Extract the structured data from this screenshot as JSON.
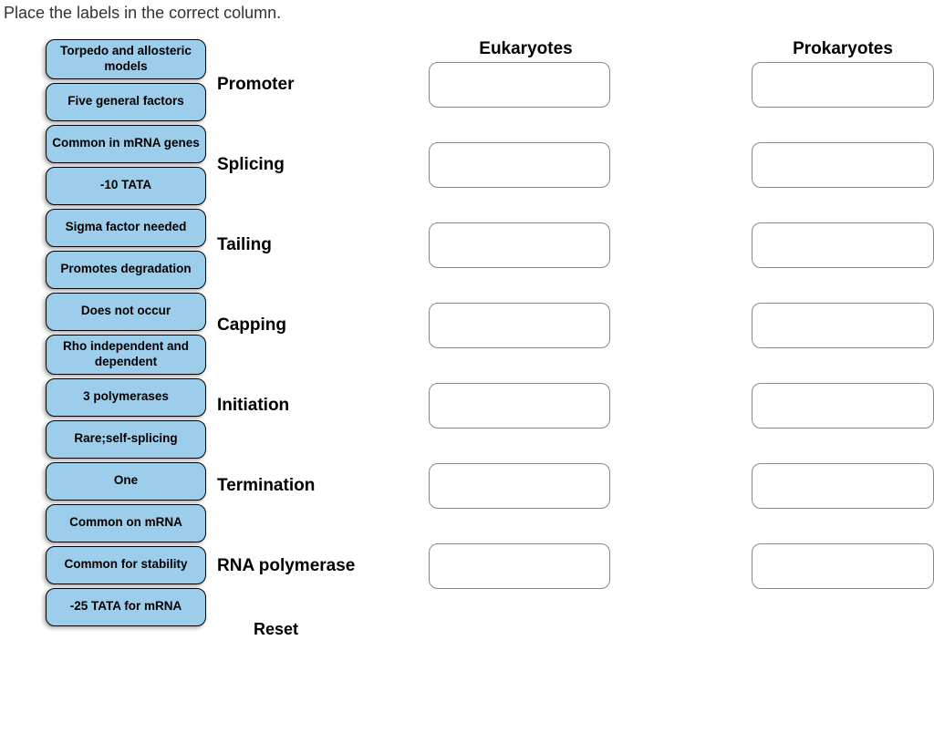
{
  "instruction": "Place the labels in the correct column.",
  "columns": {
    "eukaryotes": "Eukaryotes",
    "prokaryotes": "Prokaryotes"
  },
  "rows": [
    {
      "label": "Promoter"
    },
    {
      "label": "Splicing"
    },
    {
      "label": "Tailing"
    },
    {
      "label": "Capping"
    },
    {
      "label": "Initiation"
    },
    {
      "label": "Termination"
    },
    {
      "label": "RNA polymerase"
    }
  ],
  "labels": [
    "Torpedo and allosteric models",
    "Five general factors",
    "Common in mRNA genes",
    "-10 TATA",
    "Sigma factor needed",
    "Promotes degradation",
    "Does not occur",
    "Rho independent and dependent",
    "3 polymerases",
    "Rare;self-splicing",
    "One",
    "Common on mRNA",
    "Common for stability",
    "-25 TATA for mRNA"
  ],
  "reset": "Reset"
}
